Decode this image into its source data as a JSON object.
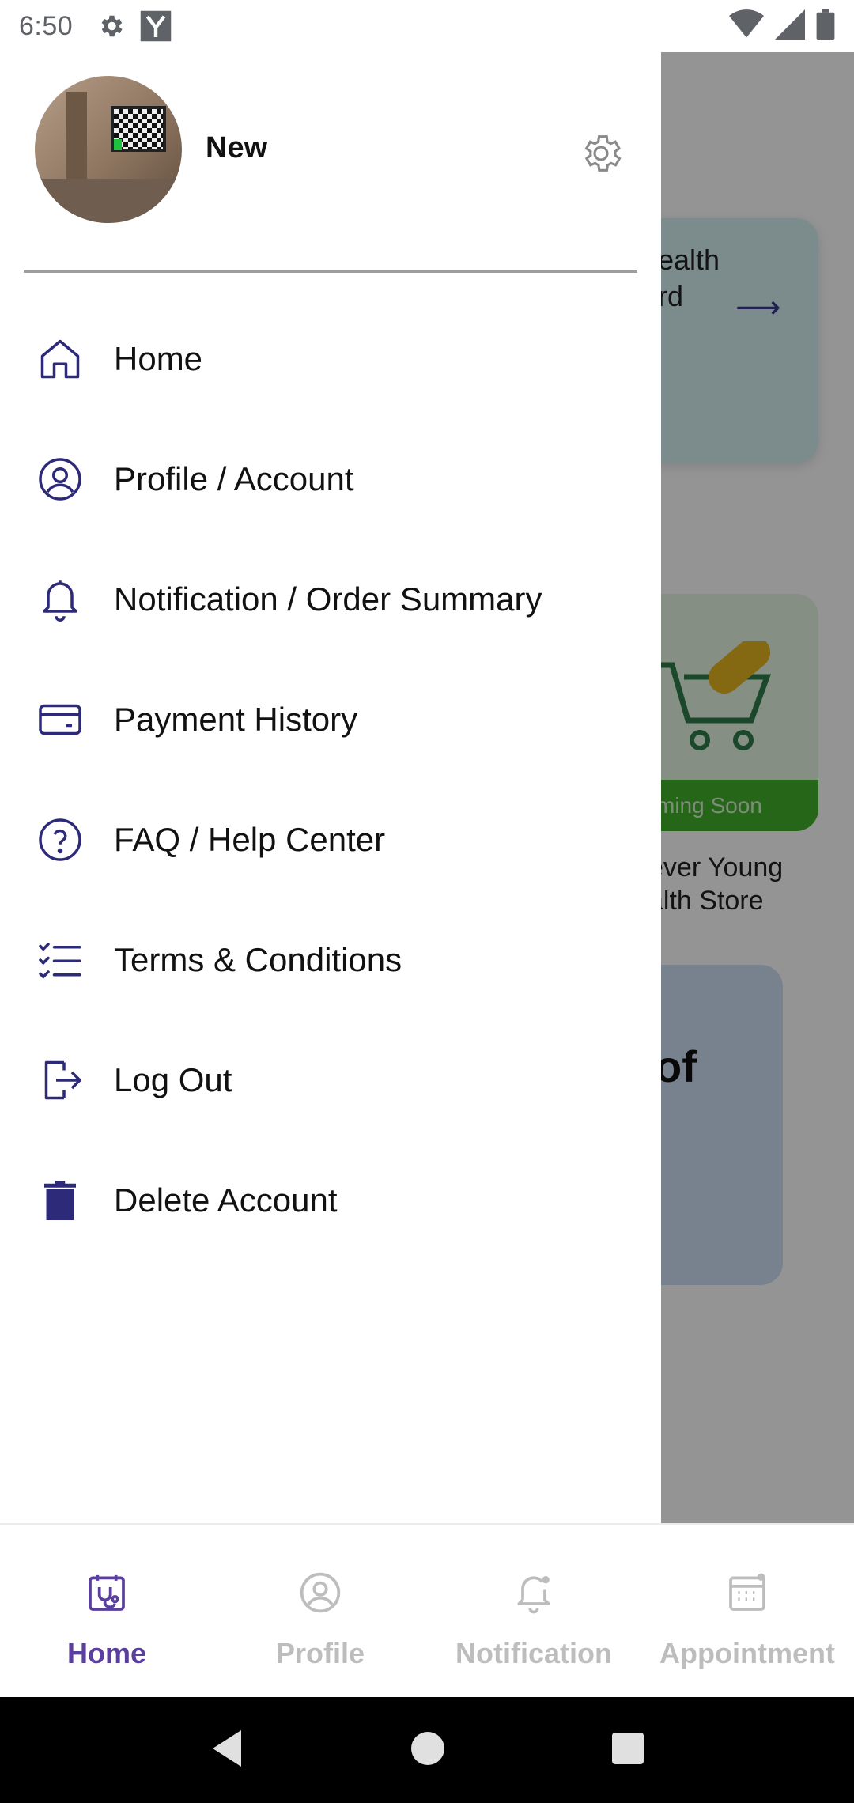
{
  "status_bar": {
    "time": "6:50",
    "left_icons": [
      "gear-icon",
      "y-app-icon"
    ],
    "right_icons": [
      "wifi-icon",
      "signal-icon",
      "battery-icon"
    ]
  },
  "drawer": {
    "user_name": "New",
    "avatar_icon": "user-avatar-photo",
    "settings_icon": "gear-icon",
    "menu": [
      {
        "label": "Home",
        "icon": "home-icon"
      },
      {
        "label": "Profile / Account",
        "icon": "user-circle-icon"
      },
      {
        "label": "Notification / Order Summary",
        "icon": "bell-icon"
      },
      {
        "label": "Payment History",
        "icon": "card-icon"
      },
      {
        "label": "FAQ / Help Center",
        "icon": "question-icon"
      },
      {
        "label": "Terms & Conditions",
        "icon": "checklist-icon"
      },
      {
        "label": "Log Out",
        "icon": "logout-icon"
      },
      {
        "label": "Delete Account",
        "icon": "trash-icon"
      }
    ]
  },
  "background": {
    "card1_text_line1": "ealth",
    "card1_text_line2": "rd",
    "card2_badge": "ming Soon",
    "card2_label_line1": "ever Young",
    "card2_label_line2": "alth Store",
    "card3_text": "of"
  },
  "bottom_nav": {
    "items": [
      {
        "label": "Home",
        "icon": "calendar-health-icon",
        "active": true
      },
      {
        "label": "Profile",
        "icon": "user-circle-icon",
        "active": false
      },
      {
        "label": "Notification",
        "icon": "bell-dot-icon",
        "active": false
      },
      {
        "label": "Appointment",
        "icon": "calendar-icon",
        "active": false
      }
    ]
  },
  "colors": {
    "accent": "#5b3f9e",
    "icon_navy": "#2d2a7a",
    "inactive": "#bdbdbd"
  }
}
